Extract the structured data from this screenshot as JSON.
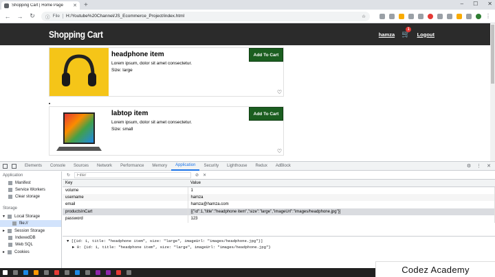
{
  "browser": {
    "tab_title": "Shopping Cart | Home Page",
    "url_scheme": "File",
    "url": "H:/Youtube%20Channel/JS_Ecommerce_Project/index.html"
  },
  "navbar": {
    "brand": "Shopping Cart",
    "username": "hamza",
    "cart_count": "1",
    "logout": "Logout"
  },
  "products": [
    {
      "title": "headphone item",
      "description": "Lorem ipsum, dolor sit amet consectetur.",
      "size": "Size: large",
      "button": "Add To Cart"
    },
    {
      "title": "labtop item",
      "description": "Lorem ipsum, dolor sit amet consectetur.",
      "size": "Size: small",
      "button": "Add To Cart"
    }
  ],
  "devtools": {
    "tabs": [
      "Elements",
      "Console",
      "Sources",
      "Network",
      "Performance",
      "Memory",
      "Application",
      "Security",
      "Lighthouse",
      "Redux",
      "AdBlock"
    ],
    "active_tab": "Application",
    "sidebar": {
      "application_label": "Application",
      "app_items": [
        "Manifest",
        "Service Workers",
        "Clear storage"
      ],
      "storage_label": "Storage",
      "storage_items": [
        "Local Storage",
        "file://",
        "Session Storage",
        "IndexedDB",
        "Web SQL",
        "Cookies"
      ]
    },
    "filter_placeholder": "Filter",
    "table": {
      "key_header": "Key",
      "value_header": "Value",
      "rows": [
        {
          "key": "volume",
          "value": "1"
        },
        {
          "key": "username",
          "value": "hamza"
        },
        {
          "key": "email",
          "value": "hamza@hamza.com"
        },
        {
          "key": "productsInCart",
          "value": "[{\"id\":1,\"title\":\"headphone item\",\"size\":\"large\",\"imageUrl\":\"images/headphone.jpg\"}]"
        },
        {
          "key": "password",
          "value": "123"
        }
      ]
    },
    "console": {
      "line1": "▼ [{id: 1, title: \"headphone item\", size: \"large\", imageUrl: \"images/headphone.jpg\"}]",
      "line2": "▶ 0: {id: 1, title: \"headphone item\", size: \"large\", imageUrl: \"images/headphone.jpg\"}"
    }
  },
  "watermark": "Codez Academy",
  "colors": {
    "navbar_bg": "#2b2b2b",
    "button_bg": "#1b5e20",
    "badge": "#e53935",
    "devtools_accent": "#1a73e8"
  }
}
